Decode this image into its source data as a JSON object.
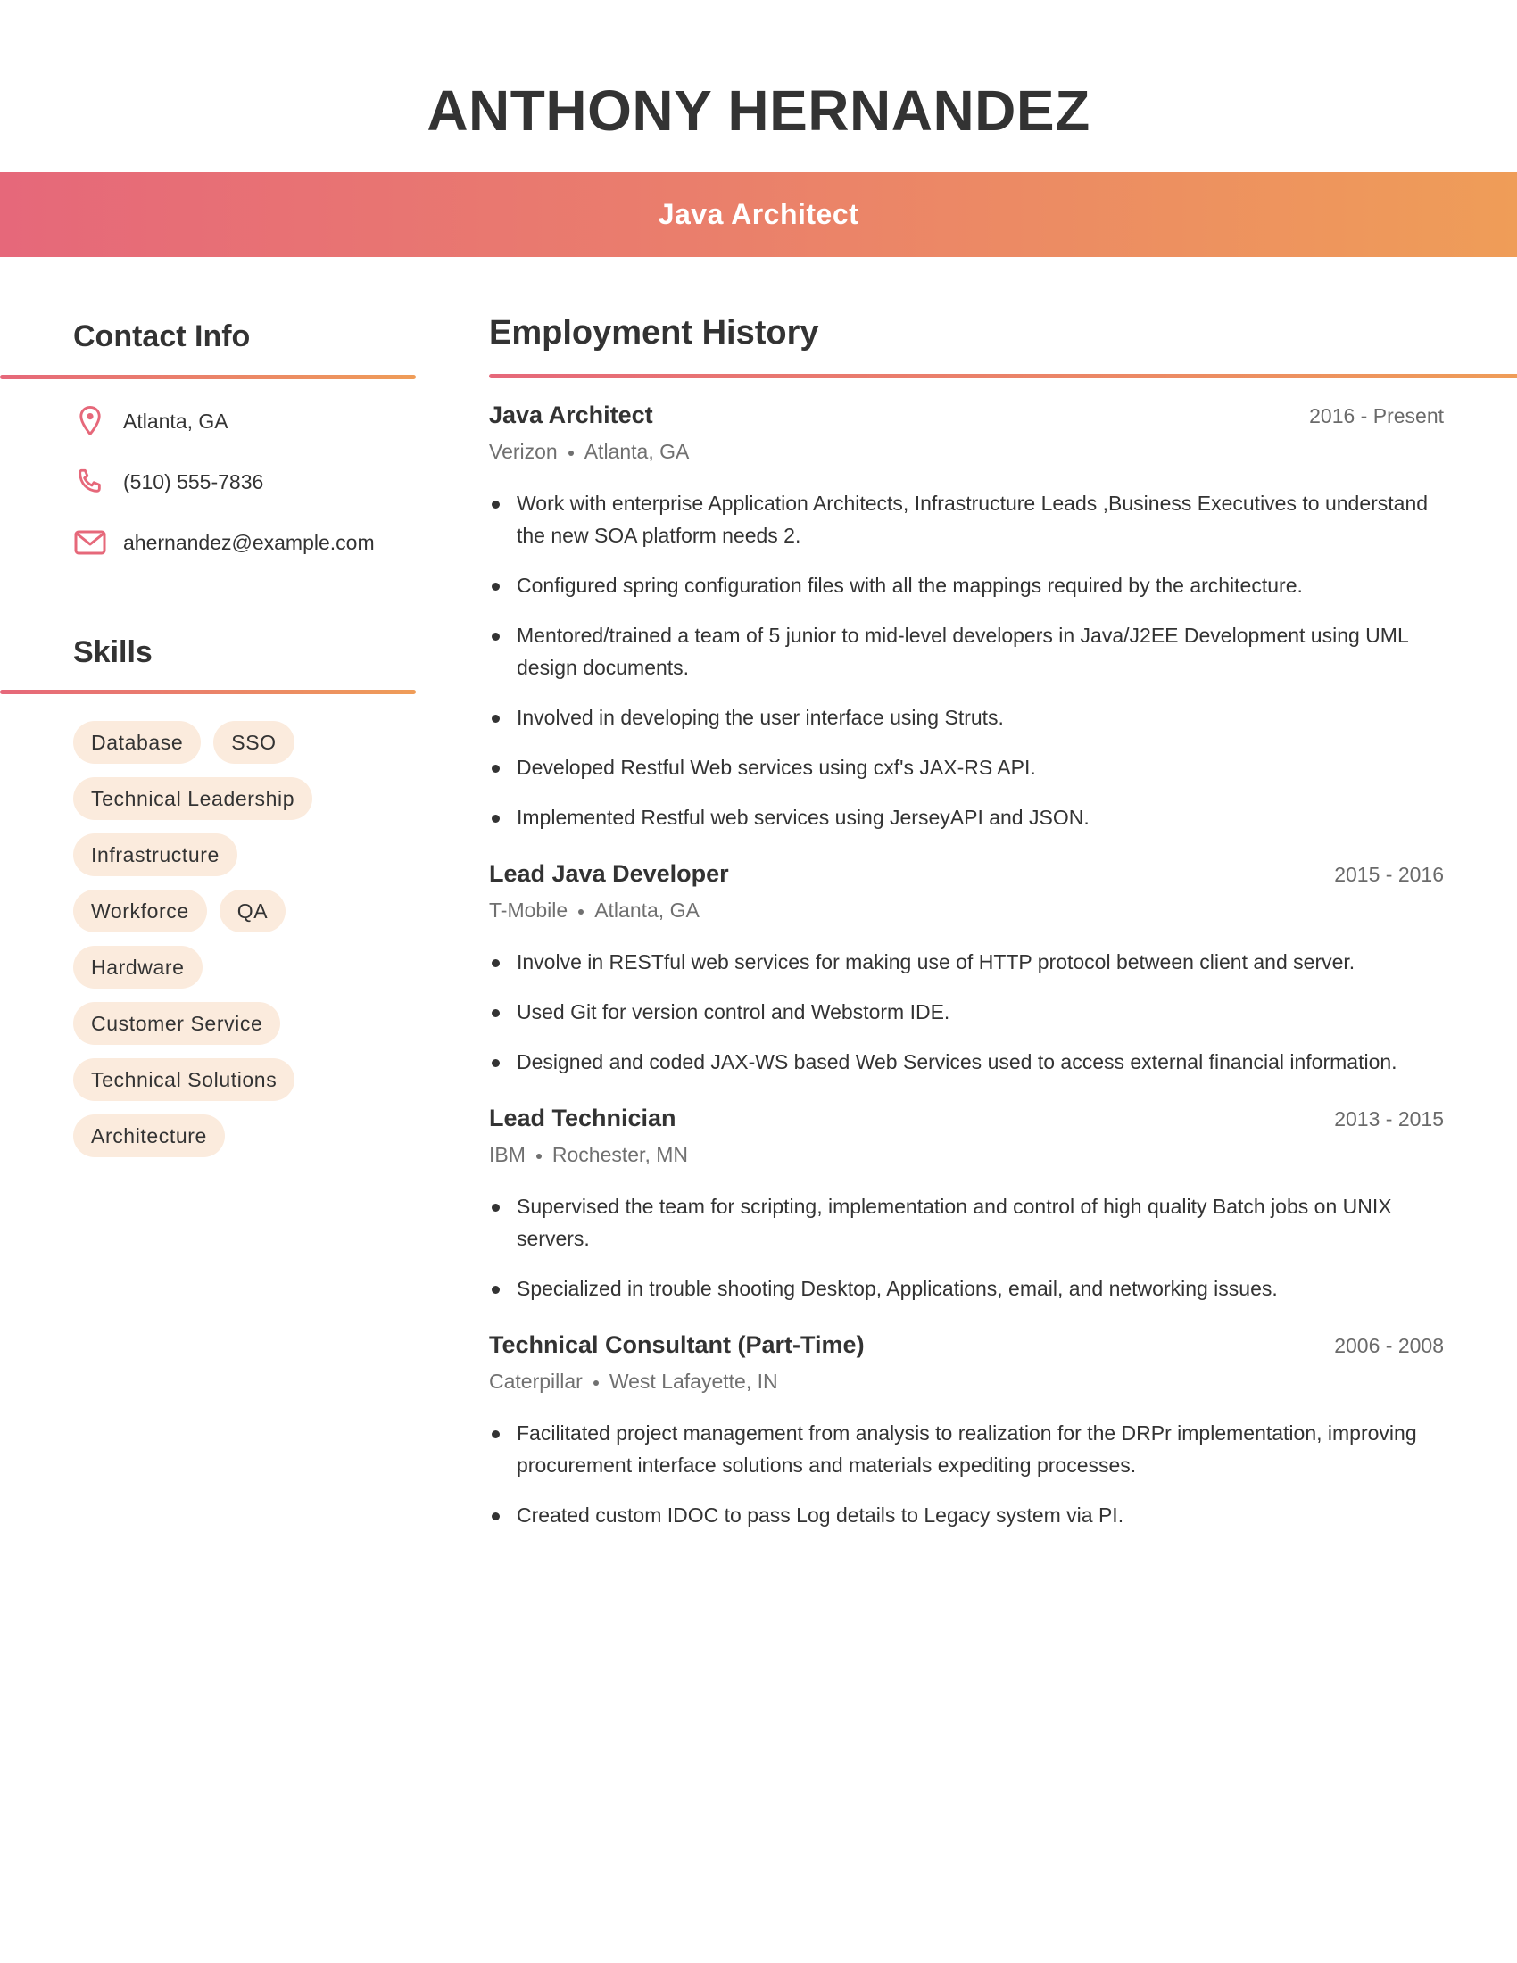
{
  "header": {
    "name": "ANTHONY HERNANDEZ",
    "title": "Java Architect"
  },
  "colors": {
    "gradient_start": "#E6687A",
    "gradient_end": "#EF9D58",
    "pill_bg": "#FBEBDD",
    "text": "#333333",
    "muted": "#707070"
  },
  "contact": {
    "heading": "Contact Info",
    "items": [
      {
        "icon": "map-pin-icon",
        "text": "Atlanta, GA"
      },
      {
        "icon": "phone-icon",
        "text": "(510) 555-7836"
      },
      {
        "icon": "mail-icon",
        "text": "ahernandez@example.com"
      }
    ]
  },
  "skills": {
    "heading": "Skills",
    "rows": [
      [
        "Database",
        "SSO"
      ],
      [
        "Technical Leadership"
      ],
      [
        "Infrastructure"
      ],
      [
        "Workforce",
        "QA"
      ],
      [
        "Hardware"
      ],
      [
        "Customer Service"
      ],
      [
        "Technical Solutions"
      ],
      [
        "Architecture"
      ]
    ]
  },
  "employment": {
    "heading": "Employment History",
    "jobs": [
      {
        "title": "Java Architect",
        "dates": "2016 - Present",
        "company": "Verizon",
        "location": "Atlanta, GA",
        "bullets": [
          "Work with enterprise Application Architects, Infrastructure Leads ,Business Executives to understand the new SOA platform needs 2.",
          "Configured spring configuration files with all the mappings required by the architecture.",
          "Mentored/trained a team of 5 junior to mid-level developers in Java/J2EE Development using UML design documents.",
          "Involved in developing the user interface using Struts.",
          "Developed Restful Web services using cxf's JAX-RS API.",
          "Implemented Restful web services using JerseyAPI and JSON."
        ]
      },
      {
        "title": "Lead Java Developer",
        "dates": "2015 - 2016",
        "company": "T-Mobile",
        "location": "Atlanta, GA",
        "bullets": [
          "Involve in RESTful web services for making use of HTTP protocol between client and server.",
          "Used Git for version control and Webstorm IDE.",
          "Designed and coded JAX-WS based Web Services used to access external financial information."
        ]
      },
      {
        "title": "Lead Technician",
        "dates": "2013 - 2015",
        "company": "IBM",
        "location": "Rochester, MN",
        "bullets": [
          "Supervised the team for scripting, implementation and control of high quality Batch jobs on UNIX servers.",
          "Specialized in trouble shooting Desktop, Applications, email, and networking issues."
        ]
      },
      {
        "title": "Technical Consultant (Part-Time)",
        "dates": "2006 - 2008",
        "company": "Caterpillar",
        "location": "West Lafayette, IN",
        "bullets": [
          "Facilitated project management from analysis to realization for the DRPr implementation, improving procurement interface solutions and materials expediting processes.",
          "Created custom IDOC to pass Log details to Legacy system via PI."
        ]
      }
    ]
  }
}
